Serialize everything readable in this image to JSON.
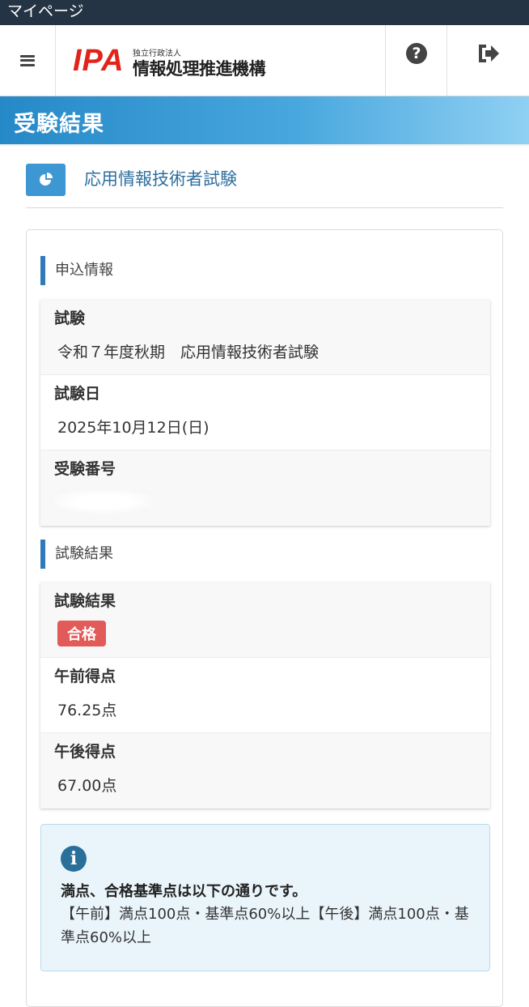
{
  "statusbar": {
    "title": "マイページ"
  },
  "header": {
    "logo_mark": "IPA",
    "logo_sub": "独立行政法人",
    "logo_org": "情報処理推進機構",
    "menu_icon": "hamburger-icon",
    "help_icon": "question-circle-icon",
    "logout_icon": "sign-out-icon"
  },
  "page": {
    "title": "受験結果"
  },
  "exam": {
    "icon": "pie-chart-icon",
    "name": "応用情報技術者試験"
  },
  "application": {
    "section_title": "申込情報",
    "rows": [
      {
        "label": "試験",
        "value": "令和７年度秋期　応用情報技術者試験"
      },
      {
        "label": "試験日",
        "value": "2025年10月12日(日)"
      },
      {
        "label": "受験番号",
        "value": ""
      }
    ]
  },
  "result": {
    "section_title": "試験結果",
    "result_label": "試験結果",
    "result_badge": "合格",
    "result_badge_color": "#e15b58",
    "rows": [
      {
        "label": "午前得点",
        "value": "76.25点"
      },
      {
        "label": "午後得点",
        "value": "67.00点"
      }
    ]
  },
  "notice": {
    "icon": "info-circle-icon",
    "heading": "満点、合格基準点は以下の通りです。",
    "body": "【午前】満点100点・基準点60%以上【午後】満点100点・基準点60%以上"
  },
  "colors": {
    "accent": "#2f7ab8",
    "title_band": "#3c97d3",
    "brand_red": "#e2231a"
  }
}
